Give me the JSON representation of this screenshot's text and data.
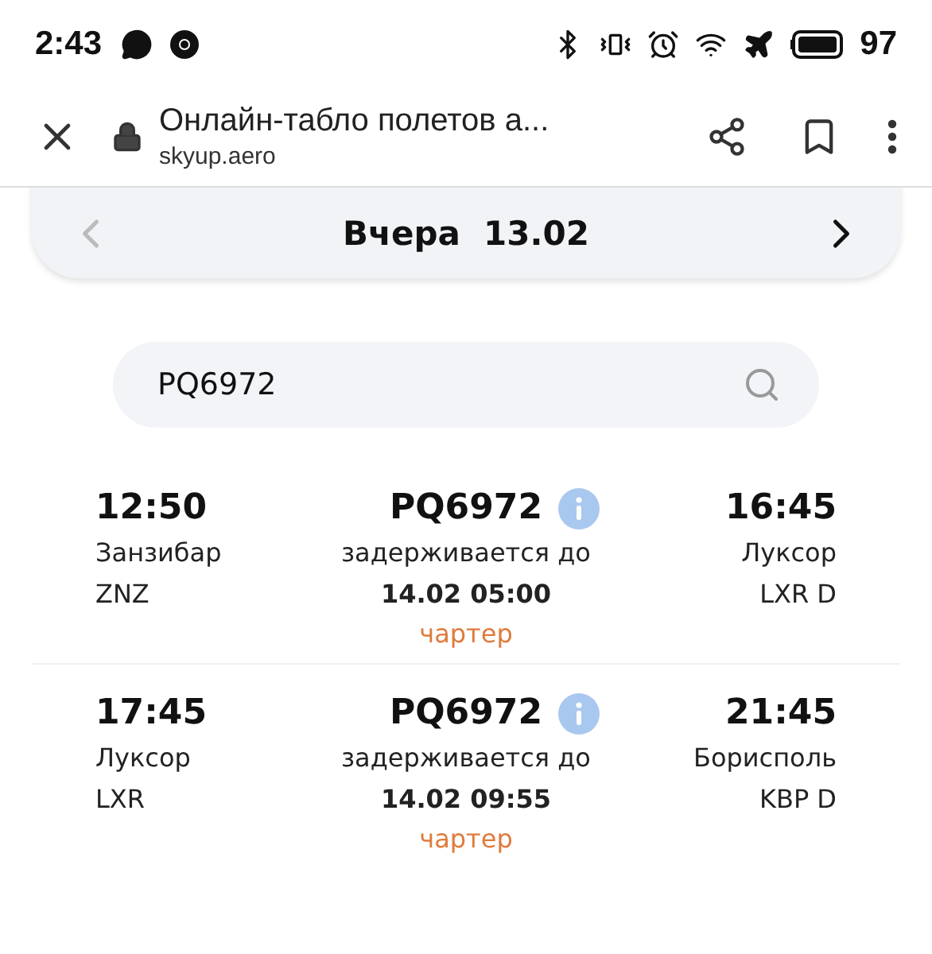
{
  "status_bar": {
    "time": "2:43",
    "battery": "97"
  },
  "browser": {
    "title": "Онлайн-табло полетов а...",
    "url": "skyup.aero"
  },
  "date_nav": {
    "label": "Вчера",
    "date": "13.02",
    "prev_disabled": true,
    "next_disabled": false
  },
  "search": {
    "value": "PQ6972"
  },
  "flights": [
    {
      "dep_time": "12:50",
      "dep_city": "Занзибар",
      "dep_code": "ZNZ",
      "flight_no": "PQ6972",
      "status": "задерживается до",
      "delayed_until": "14.02 05:00",
      "type": "чартер",
      "arr_time": "16:45",
      "arr_city": "Луксор",
      "arr_code": "LXR D"
    },
    {
      "dep_time": "17:45",
      "dep_city": "Луксор",
      "dep_code": "LXR",
      "flight_no": "PQ6972",
      "status": "задерживается до",
      "delayed_until": "14.02 09:55",
      "type": "чартер",
      "arr_time": "21:45",
      "arr_city": "Борисполь",
      "arr_code": "KBP D"
    }
  ]
}
